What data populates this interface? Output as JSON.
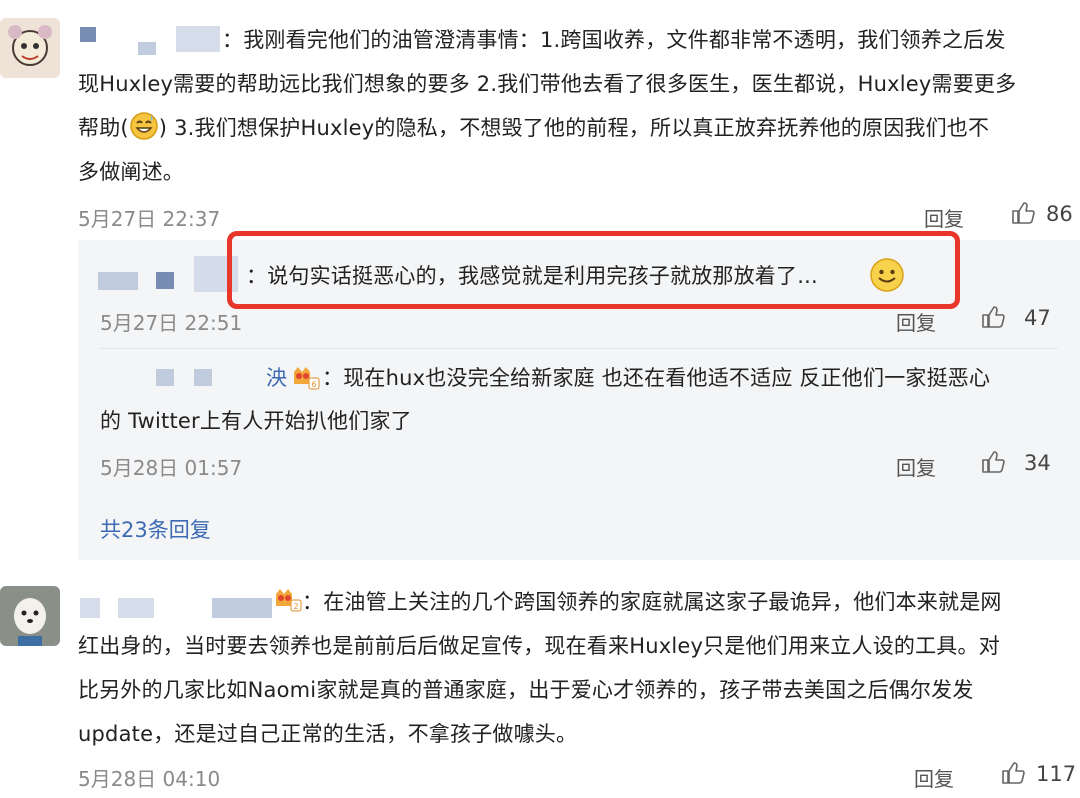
{
  "comments": [
    {
      "text_lines": [
        "：我刚看完他们的油管澄清事情：1.跨国收养，文件都非常不透明，我们领养之后发",
        "现Huxley需要的帮助远比我们想象的要多 2.我们带他去看了很多医生，医生都说，Huxley需要更多",
        "帮助(",
        ") 3.我们想保护Huxley的隐私，不想毁了他的前程，所以真正放弃抚养他的原因我们也不",
        "多做阐述。"
      ],
      "time": "5月27日 22:37",
      "reply_label": "回复",
      "likes": "86"
    },
    {
      "text_lines": [
        "：在油管上关注的几个跨国领养的家庭就属这家子最诡异，他们本来就是网",
        "红出身的，当时要去领养也是前前后后做足宣传，现在看来Huxley只是他们用来立人设的工具。对",
        "比另外的几家比如Naomi家就是真的普通家庭，出于爱心才领养的，孩子带去美国之后偶尔发发",
        "update，还是过自己正常的生活，不拿孩子做噱头。"
      ],
      "time": "5月28日 04:10",
      "reply_label": "回复",
      "likes": "117"
    }
  ],
  "replies": [
    {
      "text": "：说句实话挺恶心的，我感觉就是利用完孩子就放那放着了...",
      "time": "5月27日 22:51",
      "reply_label": "回复",
      "likes": "47"
    },
    {
      "name_fragment": "泱",
      "text_lines": [
        "：现在hux也没完全给新家庭 也还在看他适不适应 反正他们一家挺恶心",
        "的 Twitter上有人开始扒他们家了"
      ],
      "time": "5月28日 01:57",
      "reply_label": "回复",
      "likes": "34"
    }
  ],
  "more_replies": "共23条回复",
  "icons": {
    "like": "thumbs-up-icon",
    "emoji_grin": "grinning-sweat-emoji",
    "emoji_smile": "smile-emoji"
  },
  "colors": {
    "highlight_border": "#e8362b",
    "link": "#3d6bb3",
    "reply_bg": "#f4f5f7"
  }
}
